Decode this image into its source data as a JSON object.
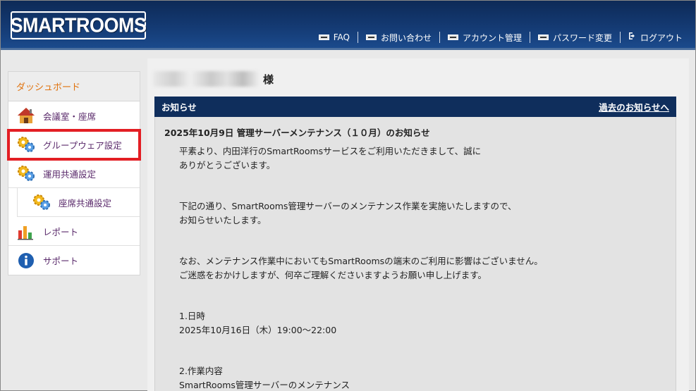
{
  "header": {
    "logo": "SMARTROOMS",
    "nav": [
      {
        "label": "FAQ"
      },
      {
        "label": "お問い合わせ"
      },
      {
        "label": "アカウント管理"
      },
      {
        "label": "パスワード変更"
      }
    ],
    "logout": "ログアウト"
  },
  "sidebar": {
    "dashboard": "ダッシュボード",
    "items": [
      {
        "label": "会議室・座席"
      },
      {
        "label": "グループウェア設定"
      },
      {
        "label": "運用共通設定"
      },
      {
        "label": "座席共通設定"
      },
      {
        "label": "レポート"
      },
      {
        "label": "サポート"
      }
    ]
  },
  "main": {
    "honorific": "様",
    "notice_header": "お知らせ",
    "past_link": "過去のお知らせへ",
    "notice_title": "2025年10月9日 管理サーバーメンテナンス（１０月）のお知らせ",
    "paragraphs": [
      [
        "平素より、内田洋行のSmartRoomsサービスをご利用いただきまして、誠に",
        "ありがとうございます。"
      ],
      [
        "下記の通り、SmartRooms管理サーバーのメンテナンス作業を実施いたしますので、",
        "お知らせいたします。"
      ],
      [
        "なお、メンテナンス作業中においてもSmartRoomsの端末のご利用に影響はございません。",
        "ご迷惑をおかけしますが、何卒ご理解くださいますようお願い申し上げます。"
      ],
      [
        "1.日時",
        "2025年10月16日（木）19:00～22:00"
      ],
      [
        "2.作業内容",
        "SmartRooms管理サーバーのメンテナンス"
      ]
    ]
  },
  "colors": {
    "header_bg": "#143a73",
    "notice_bar": "#0f2e5c",
    "dashboard_text": "#e0730f",
    "highlight": "#e31e24"
  }
}
